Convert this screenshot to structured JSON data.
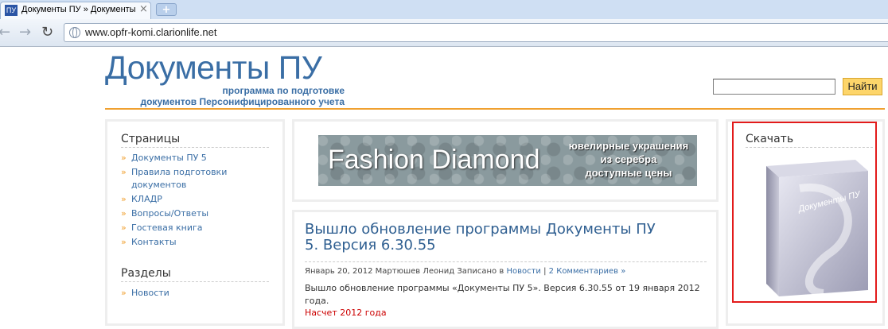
{
  "browser": {
    "tab_favicon": "ПУ",
    "tab_title": "Документы ПУ » Документы",
    "tab_close": "×",
    "new_tab": "+",
    "url": "www.opfr-komi.clarionlife.net"
  },
  "header": {
    "site_title": "Документы ПУ",
    "site_desc_line1": "программа по подготовке",
    "site_desc_line2": "документов Персонифицированного учета",
    "search_button": "Найти"
  },
  "sidebar": {
    "pages_title": "Страницы",
    "pages": [
      "Документы ПУ 5",
      "Правила подготовки документов",
      "КЛАДР",
      "Вопросы/Ответы",
      "Гостевая книга",
      "Контакты"
    ],
    "sections_title": "Разделы",
    "sections": [
      "Новости"
    ]
  },
  "ad": {
    "title": "Fashion Diamond",
    "tag_line1": "ювелирные украшения",
    "tag_line2": "из серебра",
    "tag_line3": "доступные цены"
  },
  "post": {
    "title": "Вышло обновление программы Документы ПУ 5. Версия 6.30.55",
    "date": "Январь 20, 2012",
    "author": "Мартюшев Леонид",
    "filed_in": "Записано в",
    "category": "Новости",
    "separator": "|",
    "comments": "2 Комментариев »",
    "body": "Вышло обновление программы «Документы ПУ 5». Версия 6.30.55 от 19 января 2012 года.",
    "red_link": "Насчет 2012 года"
  },
  "download": {
    "title": "Скачать",
    "box_label": "Документы ПУ"
  },
  "colors": {
    "accent_orange": "#f0a030",
    "title_blue": "#3a6ea5",
    "highlight_red": "#e31b1b"
  }
}
